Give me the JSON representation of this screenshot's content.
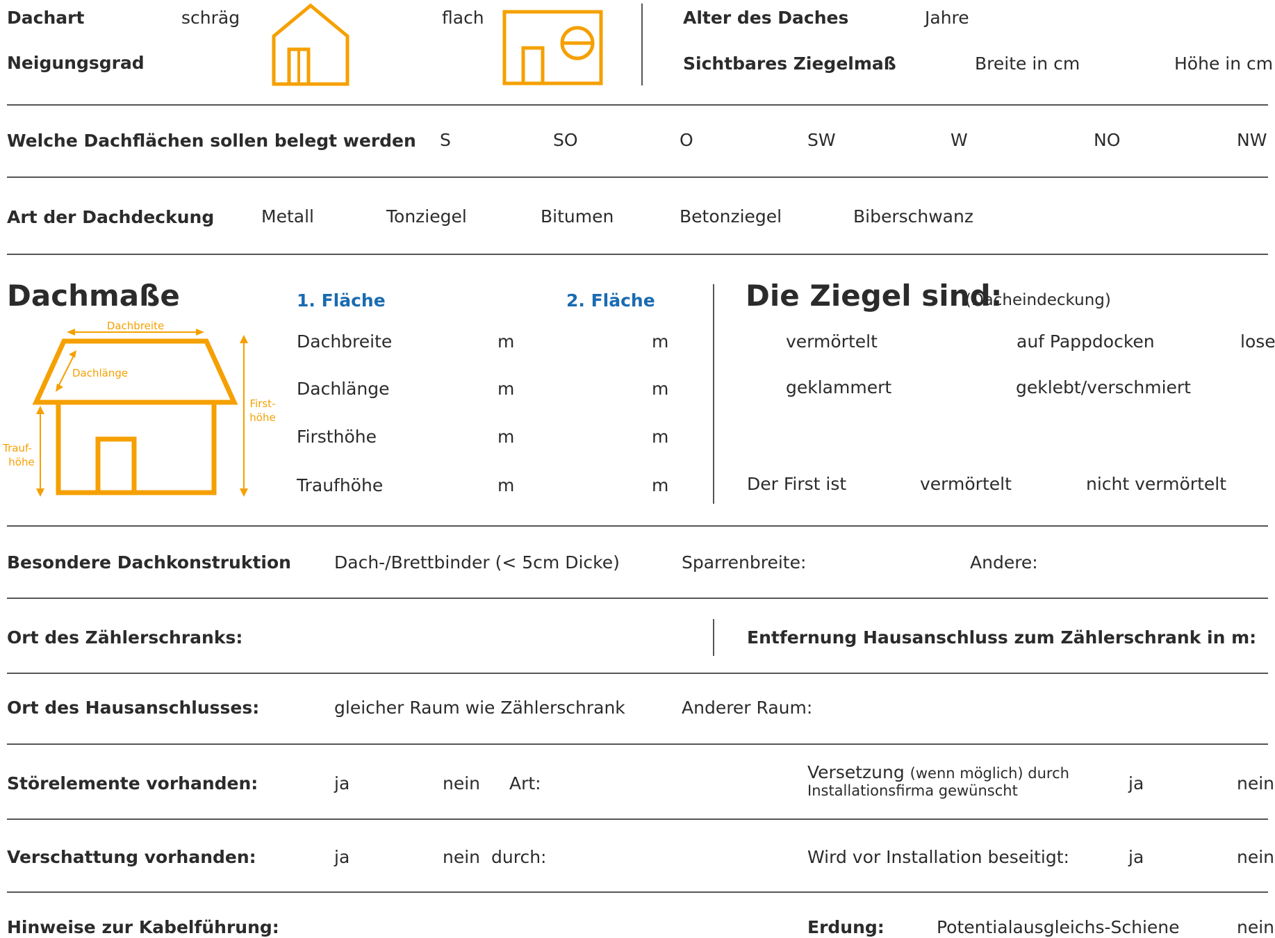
{
  "row_dachart": {
    "label": "Dachart",
    "option_schraeg": "schräg",
    "option_flach": "flach",
    "neigungsgrad": "Neigungsgrad",
    "alter_label": "Alter des Daches",
    "alter_unit": "Jahre",
    "ziegelmass_label": "Sichtbares Ziegelmaß",
    "breite_unit": "Breite in cm",
    "hoehe_unit": "Höhe in cm"
  },
  "row_dachflaechen": {
    "label": "Welche Dachflächen sollen belegt werden",
    "options": [
      "S",
      "SO",
      "O",
      "SW",
      "W",
      "NO",
      "NW"
    ]
  },
  "row_dachdeckung": {
    "label": "Art der Dachdeckung",
    "options": [
      "Metall",
      "Tonziegel",
      "Bitumen",
      "Betonziegel",
      "Biberschwanz"
    ]
  },
  "dachmasse": {
    "title": "Dachmaße",
    "diagram": {
      "dachbreite": "Dachbreite",
      "dachlaenge": "Dachlänge",
      "firsthoehe_1": "First-",
      "firsthoehe_2": "höhe",
      "traufhoehe_1": "Trauf-",
      "traufhoehe_2": "höhe"
    },
    "flaeche1": "1. Fläche",
    "flaeche2": "2. Fläche",
    "rows": [
      {
        "label": "Dachbreite",
        "unit1": "m",
        "unit2": "m"
      },
      {
        "label": "Dachlänge",
        "unit1": "m",
        "unit2": "m"
      },
      {
        "label": "Firsthöhe",
        "unit1": "m",
        "unit2": "m"
      },
      {
        "label": "Traufhöhe",
        "unit1": "m",
        "unit2": "m"
      }
    ]
  },
  "ziegel": {
    "title": "Die Ziegel sind:",
    "subtitle": "(Dacheindeckung)",
    "options": [
      "vermörtelt",
      "auf Pappdocken",
      "lose",
      "geklammert",
      "geklebt/verschmiert"
    ],
    "first_label": "Der First ist",
    "first_options": [
      "vermörtelt",
      "nicht vermörtelt"
    ]
  },
  "konstruktion": {
    "label": "Besondere Dachkonstruktion",
    "option1": "Dach-/Brettbinder (< 5cm Dicke)",
    "option2": "Sparrenbreite:",
    "option3": "Andere:"
  },
  "zaehler": {
    "label": "Ort des Zählerschranks:",
    "entfernung": "Entfernung Hausanschluss zum Zählerschrank in m:"
  },
  "hausanschluss": {
    "label": "Ort des Hausanschlusses:",
    "option1": "gleicher Raum wie Zählerschrank",
    "option2": "Anderer Raum:"
  },
  "stoerelemente": {
    "label": "Störelemente vorhanden:",
    "ja": "ja",
    "nein": "nein",
    "art": "Art:",
    "versetzung": "Versetzung",
    "versetzung_small": "(wenn möglich) durch",
    "versetzung_line2": "Installationsfirma gewünscht",
    "ja2": "ja",
    "nein2": "nein"
  },
  "verschattung": {
    "label": "Verschattung vorhanden:",
    "ja": "ja",
    "nein": "nein",
    "durch": "durch:",
    "beseitigt": "Wird vor Installation beseitigt:",
    "ja2": "ja",
    "nein2": "nein"
  },
  "kabel": {
    "label": "Hinweise zur Kabelführung:",
    "erdung": "Erdung:",
    "option1": "Potentialausgleichs-Schiene",
    "option2": "nein"
  },
  "colors": {
    "accent": "#f5a000",
    "heading_blue": "#1a6bb0",
    "text": "#2b2b2b"
  },
  "icons": [
    "house-pitched-icon",
    "house-flat-icon",
    "roof-dimensions-diagram"
  ]
}
